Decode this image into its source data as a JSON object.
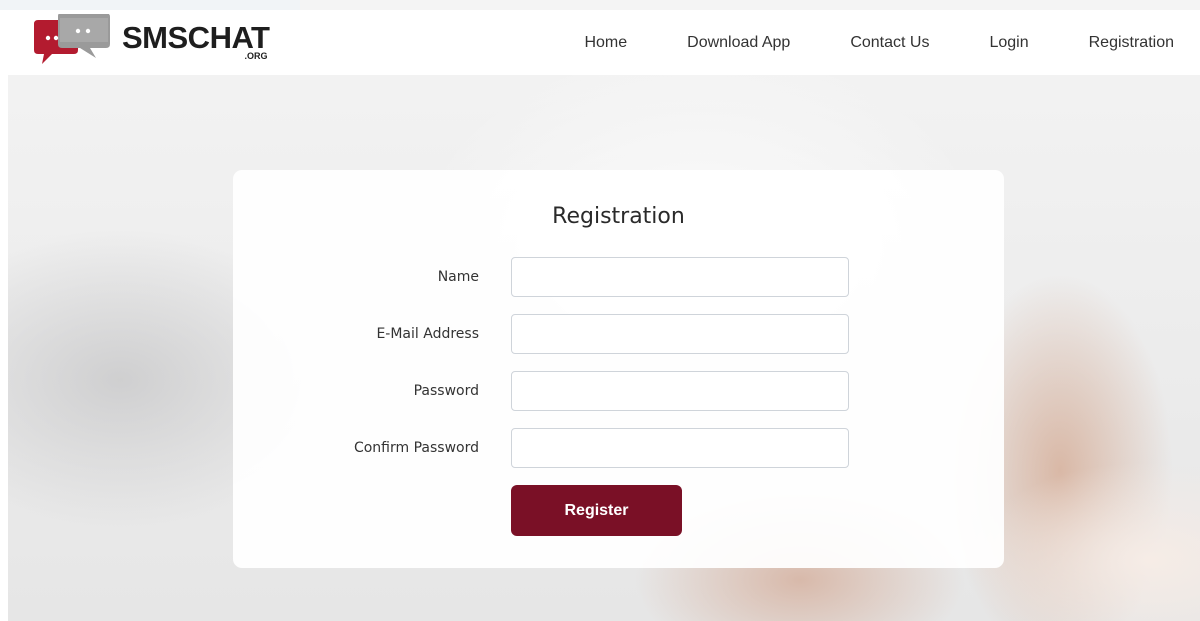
{
  "brand": {
    "name": "SMSCHAT",
    "suffix": ".ORG",
    "colors": {
      "primary": "#7a1026",
      "logo_red": "#b31b2f",
      "logo_grey": "#8f8f8f"
    }
  },
  "nav": {
    "items": [
      {
        "label": "Home"
      },
      {
        "label": "Download App"
      },
      {
        "label": "Contact Us"
      },
      {
        "label": "Login"
      },
      {
        "label": "Registration"
      }
    ]
  },
  "form": {
    "title": "Registration",
    "fields": [
      {
        "label": "Name",
        "value": ""
      },
      {
        "label": "E-Mail Address",
        "value": ""
      },
      {
        "label": "Password",
        "value": ""
      },
      {
        "label": "Confirm Password",
        "value": ""
      }
    ],
    "submit_label": "Register"
  },
  "icons": {
    "logo": "chat-bubbles-icon"
  }
}
